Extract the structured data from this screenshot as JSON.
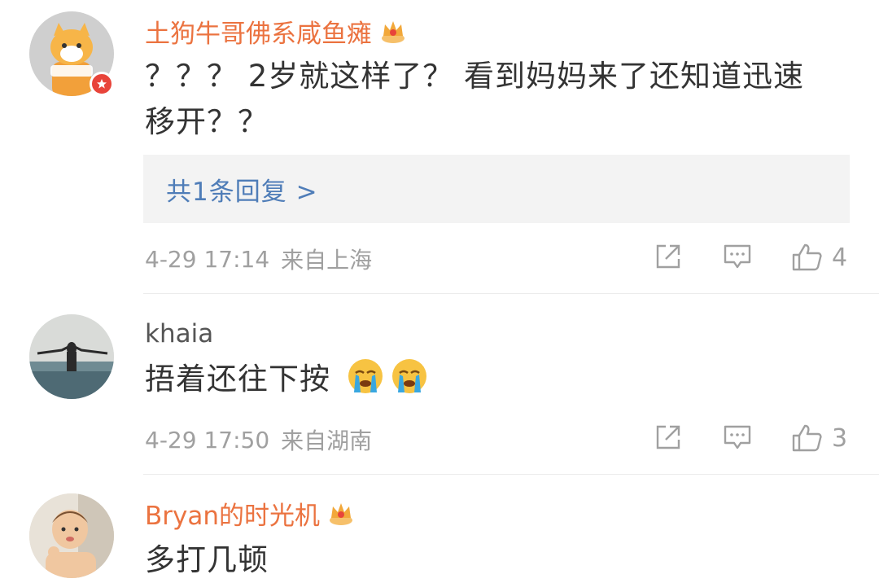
{
  "comments": [
    {
      "username": "土狗牛哥佛系咸鱼瘫",
      "text": "？？？ 2岁就这样了？ 看到妈妈来了还知道迅速移开？？",
      "replies_label": "共1条回复 >",
      "timestamp": "4-29 17:14",
      "location": "来自上海",
      "likes": "4"
    },
    {
      "username": "khaia",
      "text": "捂着还往下按",
      "timestamp": "4-29 17:50",
      "location": "来自湖南",
      "likes": "3"
    },
    {
      "username": "Bryan的时光机",
      "text": "多打几顿"
    }
  ],
  "colors": {
    "username_vip": "#eb7340",
    "username_plain": "#555555",
    "reply_link": "#4f7db8",
    "meta": "#a0a0a0"
  },
  "icons": [
    "crown-icon",
    "share-icon",
    "comment-icon",
    "like-icon",
    "crying-emoji-icon"
  ]
}
